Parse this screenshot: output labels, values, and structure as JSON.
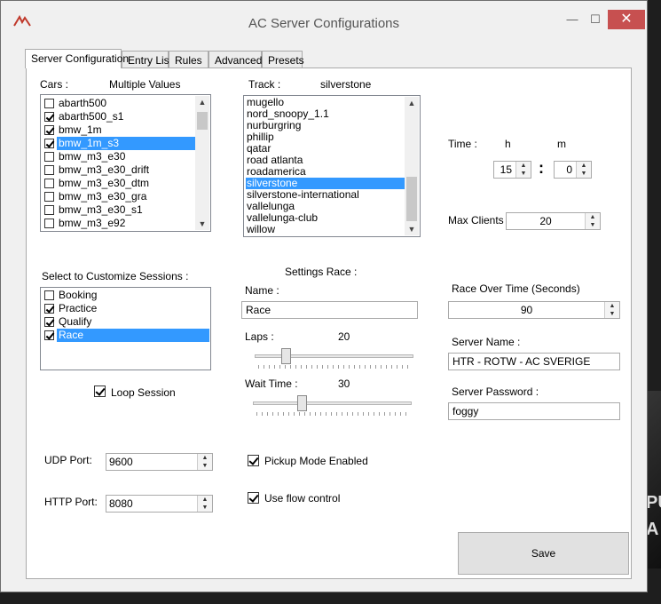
{
  "window": {
    "title": "AC Server Configurations",
    "controls": {
      "minimize": "—",
      "maximize": "☐",
      "close": "✕"
    }
  },
  "tabs": [
    "Server Configuration",
    "Entry List",
    "Rules",
    "Advanced",
    "Presets"
  ],
  "cars": {
    "label": "Cars :",
    "value_label": "Multiple Values",
    "items": [
      {
        "name": "abarth500",
        "checked": false
      },
      {
        "name": "abarth500_s1",
        "checked": true
      },
      {
        "name": "bmw_1m",
        "checked": true
      },
      {
        "name": "bmw_1m_s3",
        "checked": true,
        "selected": true
      },
      {
        "name": "bmw_m3_e30",
        "checked": false
      },
      {
        "name": "bmw_m3_e30_drift",
        "checked": false
      },
      {
        "name": "bmw_m3_e30_dtm",
        "checked": false
      },
      {
        "name": "bmw_m3_e30_gra",
        "checked": false
      },
      {
        "name": "bmw_m3_e30_s1",
        "checked": false
      },
      {
        "name": "bmw_m3_e92",
        "checked": false
      }
    ]
  },
  "track": {
    "label": "Track :",
    "value": "silverstone",
    "items": [
      "mugello",
      "nord_snoopy_1.1",
      "nurburgring",
      "phillip",
      "qatar",
      "road atlanta",
      "roadamerica",
      "silverstone",
      "silverstone-international",
      "vallelunga",
      "vallelunga-club",
      "willow"
    ],
    "selected": "silverstone"
  },
  "time": {
    "label": "Time :",
    "h_label": "h",
    "m_label": "m",
    "hour": "15",
    "separator": ":",
    "minute": "0"
  },
  "max_clients": {
    "label": "Max Clients :",
    "value": "20"
  },
  "sessions": {
    "label": "Select to Customize Sessions :",
    "items": [
      {
        "name": "Booking",
        "checked": false
      },
      {
        "name": "Practice",
        "checked": true
      },
      {
        "name": "Qualify",
        "checked": true
      },
      {
        "name": "Race",
        "checked": true,
        "selected": true
      }
    ],
    "loop_label": "Loop Session",
    "loop_checked": true
  },
  "settings": {
    "title": "Settings Race :",
    "name_label": "Name :",
    "name_value": "Race",
    "laps_label": "Laps :",
    "laps_value": "20",
    "laps_level": 0.18,
    "wait_label": "Wait Time :",
    "wait_value": "30",
    "wait_level": 0.3
  },
  "race_over_time": {
    "label": "Race Over Time (Seconds)",
    "value": "90"
  },
  "server_name": {
    "label": "Server Name :",
    "value": "HTR - ROTW - AC SVERIGE"
  },
  "server_password": {
    "label": "Server Password :",
    "value": "foggy"
  },
  "udp_port": {
    "label": "UDP Port:",
    "value": "9600"
  },
  "http_port": {
    "label": "HTTP Port:",
    "value": "8080"
  },
  "pickup_mode": {
    "label": "Pickup Mode Enabled",
    "checked": true
  },
  "flow_control": {
    "label": "Use flow control",
    "checked": true
  },
  "save_button": "Save",
  "background_text": {
    "line1": "PU",
    "line2": "A"
  }
}
